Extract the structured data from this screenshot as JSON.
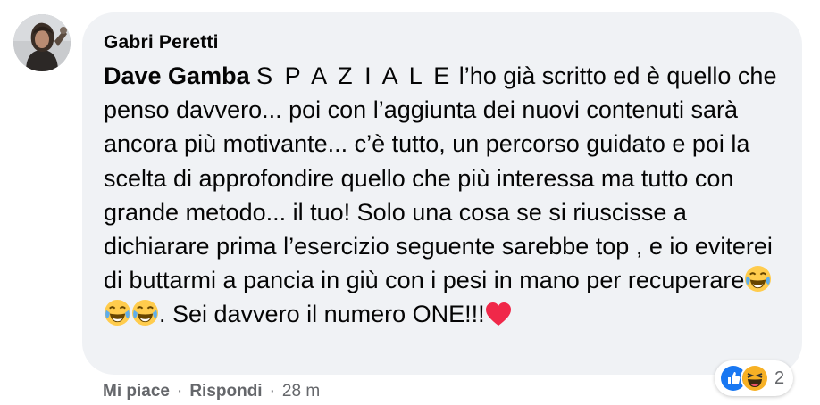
{
  "comment": {
    "author": "Gabri Peretti",
    "mention": "Dave Gamba",
    "spaced_word": "S P A Z I A L E",
    "body_main": " l’ho già scritto ed è quello che penso davvero... poi con l’aggiunta dei nuovi contenuti sarà ancora più motivante... c’è tutto, un percorso guidato e poi la scelta di approfondire quello che più interessa ma tutto con grande metodo... il tuo! Solo una cosa se si riuscisse a dichiarare prima l’esercizio seguente sarebbe top , e io eviterei di buttarmi a pancia in giù con i pesi in mano per recuperare",
    "body_tail": ". Sei davvero il numero ONE!!!",
    "inline_emojis": [
      "face-with-tears-of-joy-icon",
      "face-with-tears-of-joy-icon",
      "face-with-tears-of-joy-icon",
      "red-heart-icon"
    ]
  },
  "reactions": {
    "icons": [
      "like-icon",
      "haha-icon"
    ],
    "count": "2"
  },
  "actions": {
    "like": "Mi piace",
    "reply": "Rispondi",
    "separator": "·",
    "time": "28 m"
  },
  "colors": {
    "bubble": "#f0f2f5",
    "secondary_text": "#65676b",
    "like_blue": "#1877f2",
    "heart_red": "#f02849",
    "emoji_yellow": "#ffcc4d"
  }
}
